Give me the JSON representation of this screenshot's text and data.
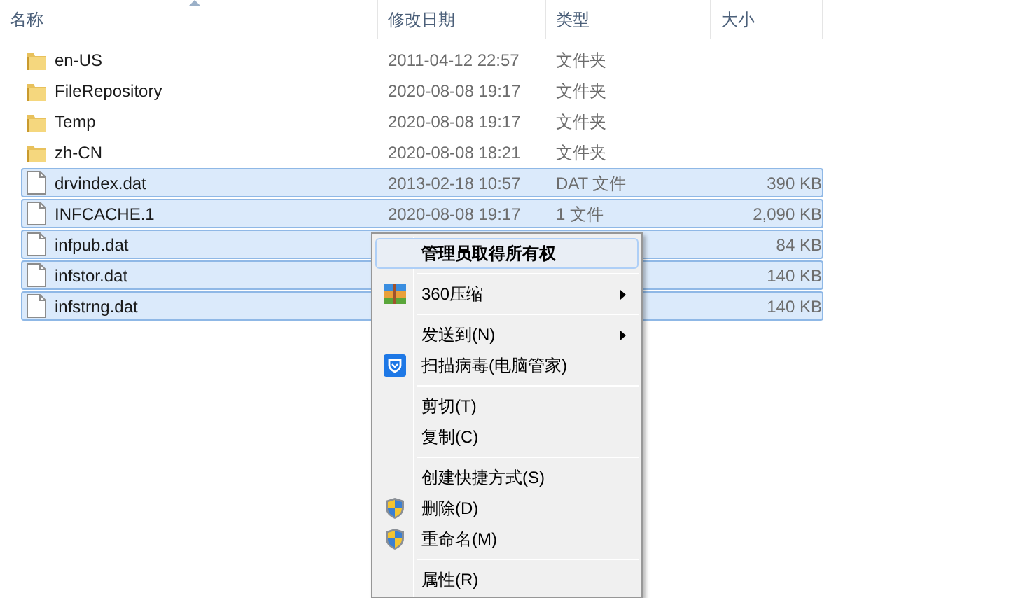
{
  "columns": [
    {
      "label": "名称",
      "sorted": true
    },
    {
      "label": "修改日期",
      "sorted": false
    },
    {
      "label": "类型",
      "sorted": false
    },
    {
      "label": "大小",
      "sorted": false
    }
  ],
  "files": [
    {
      "kind": "folder",
      "name": "en-US",
      "date": "2011-04-12 22:57",
      "type": "文件夹",
      "selected": false
    },
    {
      "kind": "folder",
      "name": "FileRepository",
      "date": "2020-08-08 19:17",
      "type": "文件夹",
      "selected": false
    },
    {
      "kind": "folder",
      "name": "Temp",
      "date": "2020-08-08 19:17",
      "type": "文件夹",
      "selected": false
    },
    {
      "kind": "folder",
      "name": "zh-CN",
      "date": "2020-08-08 18:21",
      "type": "文件夹",
      "selected": false
    },
    {
      "kind": "file",
      "name": "drvindex.dat",
      "date": "2013-02-18 10:57",
      "type": "DAT 文件",
      "size": "390 KB",
      "selected": true
    },
    {
      "kind": "file",
      "name": "INFCACHE.1",
      "date": "2020-08-08 19:17",
      "type": "1 文件",
      "size": "2,090 KB",
      "selected": true
    },
    {
      "kind": "file",
      "name": "infpub.dat",
      "size": "84 KB",
      "selected": true
    },
    {
      "kind": "file",
      "name": "infstor.dat",
      "size": "140 KB",
      "selected": true
    },
    {
      "kind": "file",
      "name": "infstrng.dat",
      "size": "140 KB",
      "selected": true
    }
  ],
  "context_menu": [
    [
      {
        "label": "管理员取得所有权",
        "bold": true,
        "selected": true,
        "submenu": false
      }
    ],
    [
      {
        "label": "360压缩",
        "kind": "archive",
        "bold": false,
        "selected": false,
        "submenu": true
      }
    ],
    [
      {
        "label": "发送到(N)",
        "bold": false,
        "selected": false,
        "submenu": true
      },
      {
        "label": "扫描病毒(电脑管家)",
        "kind": "shield",
        "bold": false,
        "selected": false,
        "submenu": false
      }
    ],
    [
      {
        "label": "剪切(T)",
        "bold": false,
        "selected": false,
        "submenu": false
      },
      {
        "label": "复制(C)",
        "bold": false,
        "selected": false,
        "submenu": false
      }
    ],
    [
      {
        "label": "创建快捷方式(S)",
        "bold": false,
        "selected": false,
        "submenu": false
      },
      {
        "label": "删除(D)",
        "kind": "uac",
        "bold": false,
        "selected": false,
        "submenu": false
      },
      {
        "label": "重命名(M)",
        "kind": "uac",
        "bold": false,
        "selected": false,
        "submenu": false
      }
    ],
    [
      {
        "label": "属性(R)",
        "bold": false,
        "selected": false,
        "submenu": false
      }
    ]
  ]
}
